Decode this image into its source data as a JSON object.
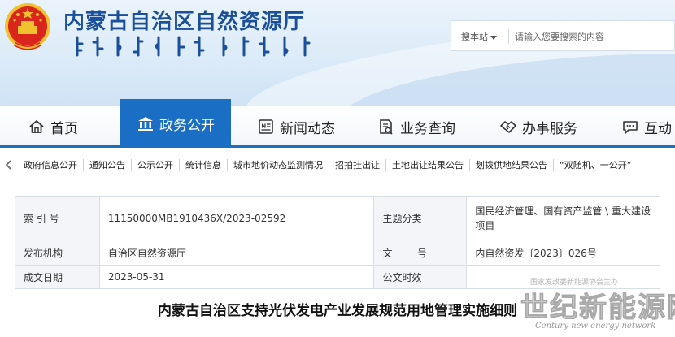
{
  "header": {
    "site_title": "内蒙古自治区自然资源厅",
    "search": {
      "scope_label": "搜本站",
      "placeholder": "请输入您要搜索的内容"
    }
  },
  "nav": {
    "items": [
      {
        "label": "首页",
        "icon": "home-icon"
      },
      {
        "label": "政务公开",
        "icon": "government-building-icon",
        "active": true
      },
      {
        "label": "新闻动态",
        "icon": "news-icon"
      },
      {
        "label": "业务查询",
        "icon": "document-search-icon"
      },
      {
        "label": "办事服务",
        "icon": "handshake-icon"
      },
      {
        "label": "互动",
        "icon": "chat-icon"
      }
    ]
  },
  "subnav": {
    "items": [
      "政府信息公开",
      "通知公告",
      "公示公开",
      "统计信息",
      "城市地价动态监测情况",
      "招拍挂出让",
      "土地出让结果公告",
      "划拨供地结果公告",
      "“双随机、一公开”"
    ]
  },
  "meta": {
    "rows": [
      {
        "label1": "索 引 号",
        "value1": "11150000MB1910436X/2023-02592",
        "label2": "主题分类",
        "value2": "国民经济管理、国有资产监管 \\ 重大建设项目"
      },
      {
        "label1": "发布机构",
        "value1": "自治区自然资源厅",
        "label2": "文        号",
        "value2": "内自然资发〔2023〕026号"
      },
      {
        "label1": "成文日期",
        "value1": "2023-05-31",
        "label2": "公文时效",
        "value2": ""
      }
    ]
  },
  "document": {
    "title": "内蒙古自治区支持光伏发电产业发展规范用地管理实施细则"
  },
  "watermark": {
    "small": "国家发改委新能源协会主办",
    "big": "世纪新能源网",
    "english": "Century new energy network"
  },
  "colors": {
    "brand_blue": "#1a6fc4",
    "title_blue": "#1a4f9c",
    "emblem_red": "#d9251c",
    "emblem_gold": "#f2c12e"
  }
}
